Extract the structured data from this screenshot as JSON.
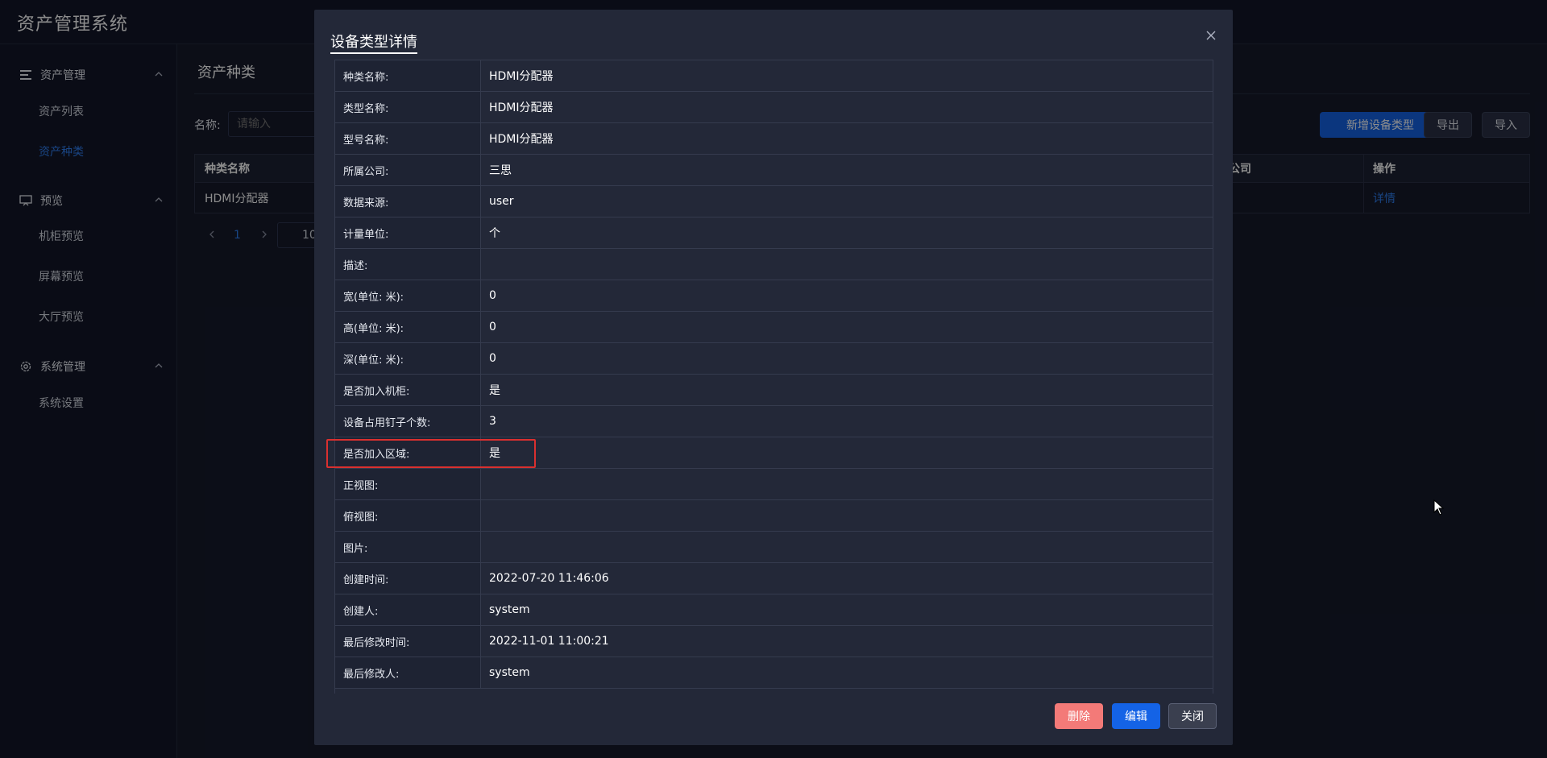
{
  "header": {
    "app_title": "资产管理系统"
  },
  "sidebar": {
    "groups": [
      {
        "label": "资产管理",
        "items": [
          "资产列表",
          "资产种类"
        ]
      },
      {
        "label": "预览",
        "items": [
          "机柜预览",
          "屏幕预览",
          "大厅预览"
        ]
      },
      {
        "label": "系统管理",
        "items": [
          "系统设置"
        ]
      }
    ],
    "active_item": "资产种类"
  },
  "main": {
    "title": "资产种类",
    "filter": {
      "label": "名称:",
      "placeholder": "请输入"
    },
    "buttons": {
      "add": "新增设备类型",
      "export": "导出",
      "import": "导入"
    },
    "table": {
      "columns": [
        "种类名称",
        "公司",
        "操作"
      ],
      "rows": [
        {
          "name": "HDMI分配器",
          "action": "详情"
        }
      ]
    },
    "pager": {
      "current_page": "1",
      "page_size": "10"
    }
  },
  "modal": {
    "title": "设备类型详情",
    "rows": [
      {
        "label": "种类名称:",
        "value": "HDMI分配器"
      },
      {
        "label": "类型名称:",
        "value": "HDMI分配器"
      },
      {
        "label": "型号名称:",
        "value": "HDMI分配器"
      },
      {
        "label": "所属公司:",
        "value": "三思"
      },
      {
        "label": "数据来源:",
        "value": "user"
      },
      {
        "label": "计量单位:",
        "value": "个"
      },
      {
        "label": "描述:",
        "value": ""
      },
      {
        "label": "宽(单位: 米):",
        "value": "0"
      },
      {
        "label": "高(单位: 米):",
        "value": "0"
      },
      {
        "label": "深(单位: 米):",
        "value": "0"
      },
      {
        "label": "是否加入机柜:",
        "value": "是"
      },
      {
        "label": "设备占用钉子个数:",
        "value": "3"
      },
      {
        "label": "是否加入区域:",
        "value": "是"
      },
      {
        "label": "正视图:",
        "value": ""
      },
      {
        "label": "俯视图:",
        "value": ""
      },
      {
        "label": "图片:",
        "value": ""
      },
      {
        "label": "创建时间:",
        "value": "2022-07-20 11:46:06"
      },
      {
        "label": "创建人:",
        "value": "system"
      },
      {
        "label": "最后修改时间:",
        "value": "2022-11-01 11:00:21"
      },
      {
        "label": "最后修改人:",
        "value": "system"
      }
    ],
    "buttons": {
      "delete": "删除",
      "edit": "编辑",
      "close": "关闭"
    }
  },
  "colors": {
    "accent": "#1463e6",
    "danger": "#f37a78",
    "highlight": "#d9302f"
  }
}
